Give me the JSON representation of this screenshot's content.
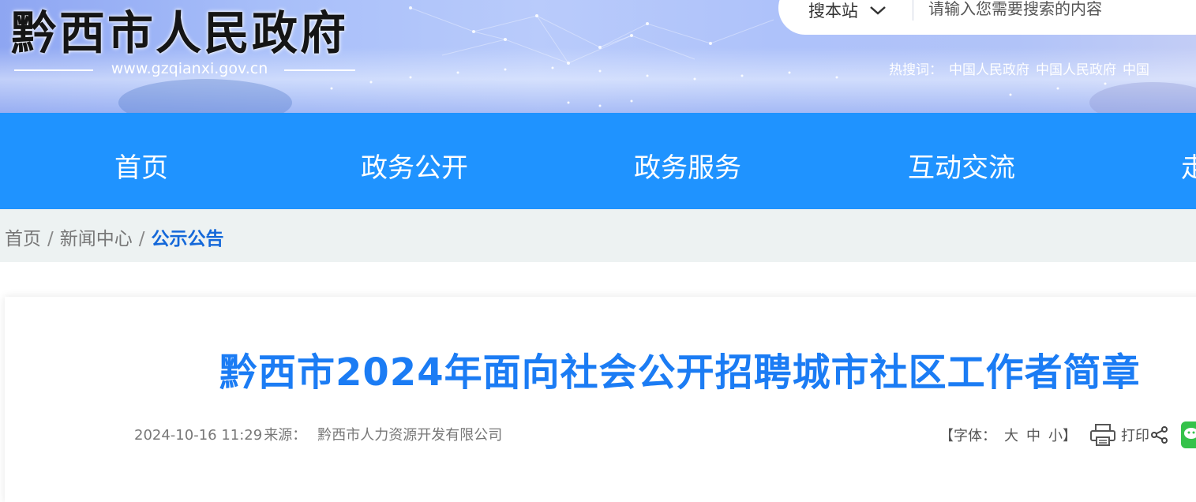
{
  "header": {
    "site_title": "黔西市人民政府",
    "site_url": "www.gzqianxi.gov.cn",
    "search_scope": "搜本站",
    "search_placeholder": "请输入您需要搜索的内容",
    "hot_label": "热搜词：",
    "hot_words": [
      "中国人民政府",
      "中国人民政府",
      "中国"
    ]
  },
  "nav": {
    "items": [
      "首页",
      "政务公开",
      "政务服务",
      "互动交流",
      "走"
    ]
  },
  "breadcrumb": {
    "items": [
      "首页",
      "新闻中心"
    ],
    "separator": "/",
    "current": "公示公告"
  },
  "article": {
    "title": "黔西市2024年面向社会公开招聘城市社区工作者简章",
    "date": "2024-10-16 11:29",
    "source_label": "来源：",
    "source": "黔西市人力资源开发有限公司",
    "font_label_open": "【字体：",
    "font_sizes": [
      "大",
      "中",
      "小"
    ],
    "font_label_close": "】",
    "print_label": "打印"
  },
  "colors": {
    "nav_bg": "#1f93ff",
    "title_blue": "#1b7cf4",
    "crumb_current": "#1468d9",
    "crumb_bg": "#edf2f2"
  },
  "icons": [
    "chevron-down-icon",
    "print-icon",
    "share-icon",
    "wechat-icon"
  ]
}
